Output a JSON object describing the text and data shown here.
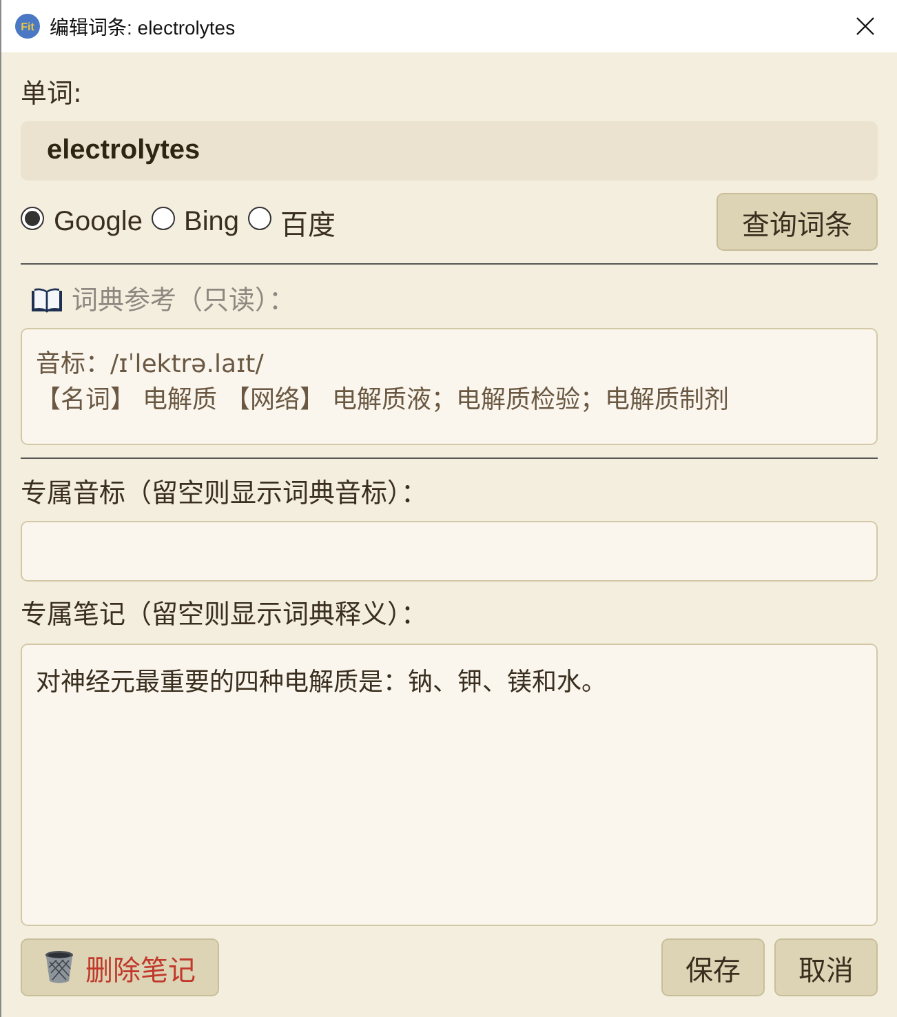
{
  "window": {
    "title": "编辑词条: electrolytes",
    "logo_text": "Fit"
  },
  "word": {
    "label": "单词:",
    "value": "electrolytes"
  },
  "sources": [
    {
      "label": "Google",
      "selected": true
    },
    {
      "label": "Bing",
      "selected": false
    },
    {
      "label": "百度",
      "selected": false
    }
  ],
  "lookup_button": "查询词条",
  "dictionary": {
    "label": "词典参考（只读）：",
    "lines": [
      "音标：/ɪˈlektrə.laɪt/",
      "【名词】 电解质 【网络】 电解质液；电解质检验；电解质制剂"
    ]
  },
  "custom_phonetic": {
    "label": "专属音标（留空则显示词典音标）："
  },
  "custom_note": {
    "label": "专属笔记（留空则显示词典释义）：",
    "value": "对神经元最重要的四种电解质是：钠、钾、镁和水。"
  },
  "buttons": [
    {
      "label": "删除笔记",
      "kind": "danger"
    },
    {
      "label": "保存",
      "kind": "normal"
    },
    {
      "label": "取消",
      "kind": "normal"
    }
  ]
}
